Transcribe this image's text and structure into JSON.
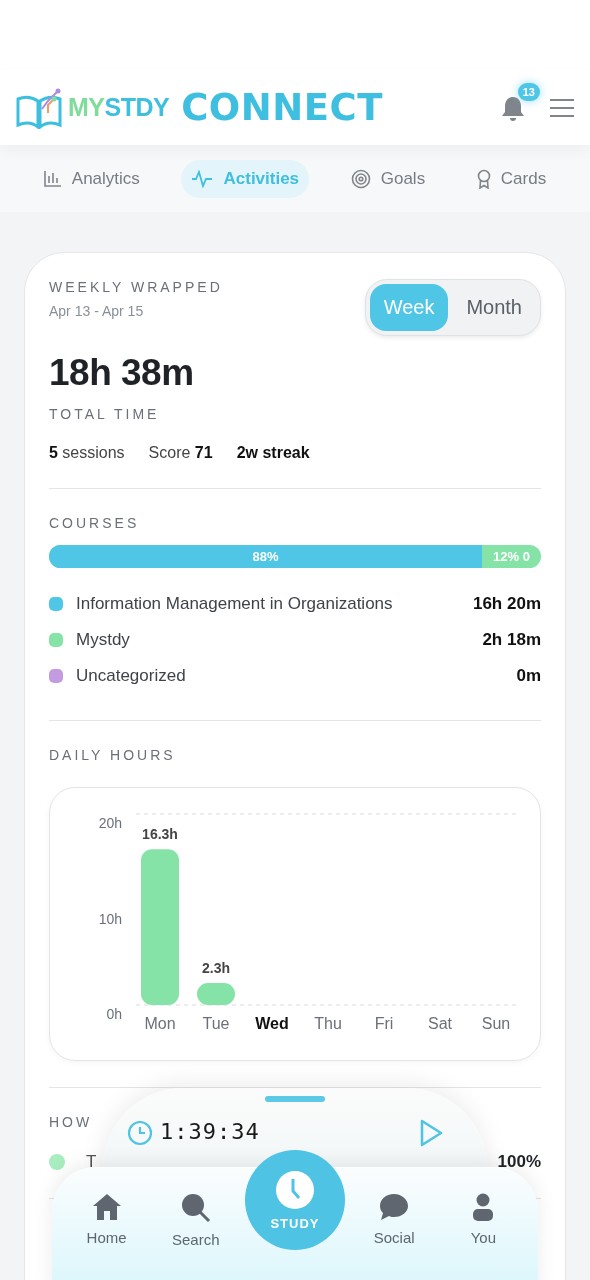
{
  "header": {
    "logo": {
      "part_a": "MY",
      "part_b": "STDY",
      "suffix": "CONNECT"
    },
    "notifications": "13"
  },
  "tabs": [
    {
      "label": "Analytics",
      "selected": false
    },
    {
      "label": "Activities",
      "selected": true
    },
    {
      "label": "Goals",
      "selected": false
    },
    {
      "label": "Cards",
      "selected": false
    }
  ],
  "summary": {
    "title": "WEEKLY WRAPPED",
    "range": "Apr 13 - Apr 15",
    "periods": [
      {
        "label": "Week",
        "selected": true
      },
      {
        "label": "Month",
        "selected": false
      }
    ],
    "total": "18h 38m",
    "total_label": "TOTAL TIME",
    "stats": [
      {
        "text": "**5** sessions",
        "bold": false
      },
      {
        "text": "Score **71**",
        "bold": false
      },
      {
        "text": "2w streak",
        "bold": true
      }
    ]
  },
  "courses": {
    "title": "COURSES",
    "share": {
      "label": "88%",
      "level": 0.88,
      "rest_label": "12% 0"
    },
    "items": [
      {
        "name": "Information Management in Organizations",
        "time": "16h 20m",
        "color": "#4fc6e6"
      },
      {
        "name": "Mystdy",
        "time": "2h 18m",
        "color": "#86e3a8"
      },
      {
        "name": "Uncategorized",
        "time": "0m",
        "color": "#c39be0"
      }
    ]
  },
  "daily": {
    "title": "DAILY HOURS",
    "day_states": [
      {
        "selected": false
      },
      {
        "selected": false
      },
      {
        "selected": true
      },
      {
        "selected": false
      },
      {
        "selected": false
      },
      {
        "selected": false
      },
      {
        "selected": false
      }
    ],
    "chart_data": {
      "type": "bar",
      "categories": [
        "Mon",
        "Tue",
        "Wed",
        "Thu",
        "Fri",
        "Sat",
        "Sun"
      ],
      "series": [
        {
          "color": "#86e3a8",
          "values": [
            16.3,
            2.3,
            0,
            0,
            0,
            0,
            0
          ]
        }
      ],
      "ylim": [
        0,
        20
      ],
      "yticks": [
        {
          "value": 0,
          "label": "0h"
        },
        {
          "value": 10,
          "label": "10h"
        },
        {
          "value": 20,
          "label": "20h"
        }
      ],
      "value_labels": [
        "16.3h",
        "2.3h",
        null,
        null,
        null,
        null,
        null
      ]
    }
  },
  "how": {
    "title": "HOW",
    "row": {
      "name": "T",
      "value": "100%",
      "color": "#a8ecc0"
    }
  },
  "timer": {
    "time": "1:39:34"
  },
  "nav": {
    "items": [
      {
        "label": "Home"
      },
      {
        "label": "Search"
      },
      {
        "label": "STUDY",
        "kind": "center"
      },
      {
        "label": "Social"
      },
      {
        "label": "You"
      }
    ]
  }
}
